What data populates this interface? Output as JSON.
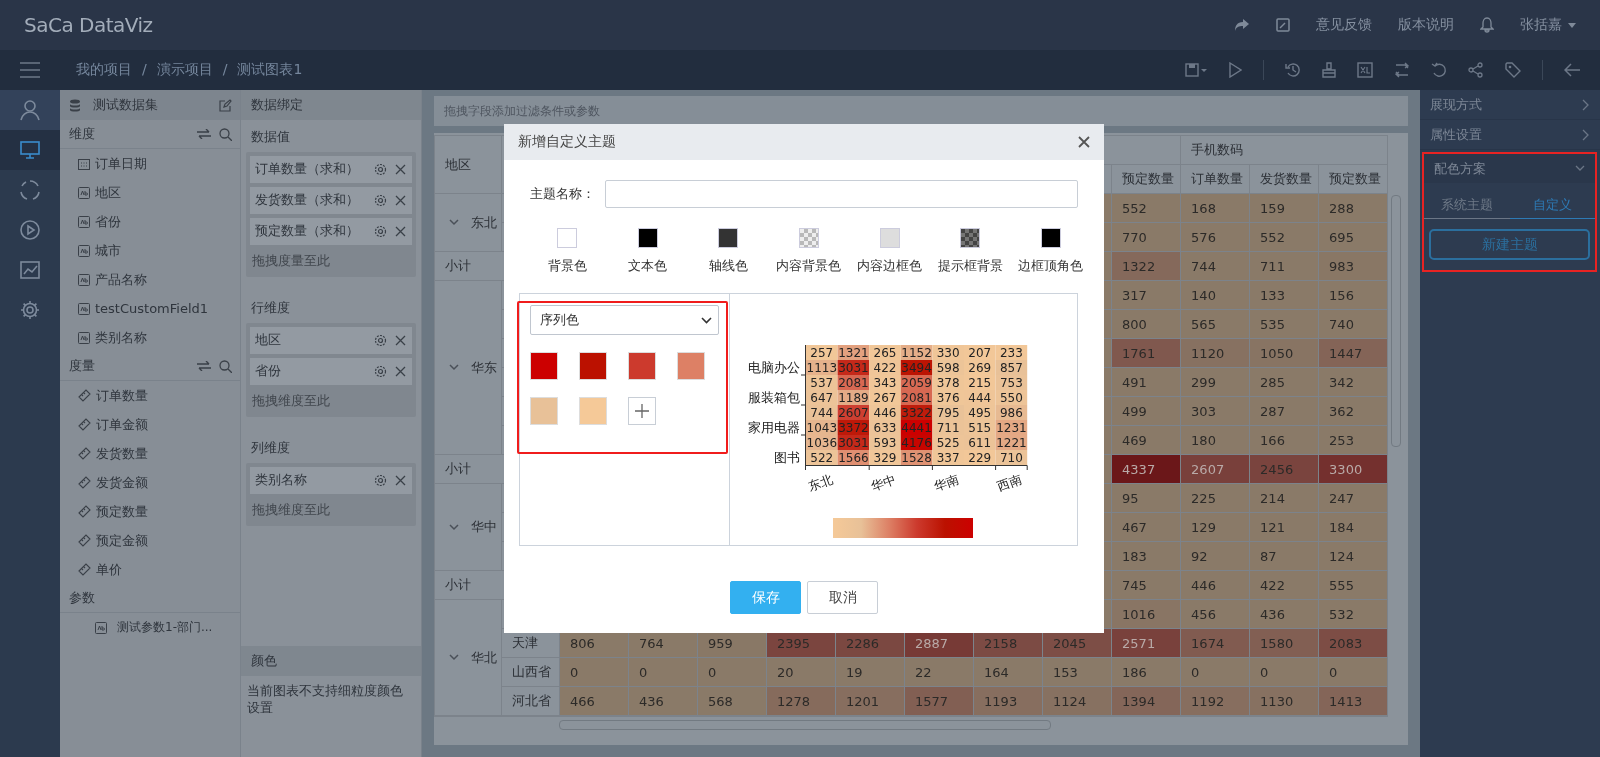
{
  "topbar": {
    "logo": "SaCa DataViz",
    "links": [
      "意见反馈",
      "版本说明"
    ],
    "user": "张括嘉"
  },
  "breadcrumb": {
    "items": [
      "我的项目",
      "演示项目",
      "测试图表1"
    ],
    "separator": "/"
  },
  "rail": [
    {
      "kind": "user",
      "selected": false
    },
    {
      "kind": "monitor",
      "selected": true
    },
    {
      "kind": "loader",
      "selected": false
    },
    {
      "kind": "play",
      "selected": false
    },
    {
      "kind": "chart",
      "selected": false
    },
    {
      "kind": "gear",
      "selected": false
    }
  ],
  "fields": {
    "dataset": "测试数据集",
    "sections": [
      {
        "title": "维度",
        "tools": true,
        "items": [
          {
            "kind": "date",
            "label": "订单日期"
          },
          {
            "kind": "text",
            "label": "地区"
          },
          {
            "kind": "text",
            "label": "省份"
          },
          {
            "kind": "text",
            "label": "城市"
          },
          {
            "kind": "text",
            "label": "产品名称"
          },
          {
            "kind": "text",
            "label": "testCustomField1"
          },
          {
            "kind": "text",
            "label": "类别名称"
          }
        ]
      },
      {
        "title": "度量",
        "tools": true,
        "items": [
          {
            "kind": "measure",
            "label": "订单数量"
          },
          {
            "kind": "measure",
            "label": "订单金额"
          },
          {
            "kind": "measure",
            "label": "发货数量"
          },
          {
            "kind": "measure",
            "label": "发货金额"
          },
          {
            "kind": "measure",
            "label": "预定数量"
          },
          {
            "kind": "measure",
            "label": "预定金额"
          },
          {
            "kind": "measure",
            "label": "单价"
          }
        ]
      },
      {
        "title": "参数",
        "tools": false,
        "items": [
          {
            "kind": "param",
            "label": "测试参数1-部门..."
          }
        ]
      }
    ]
  },
  "binding": {
    "title": "数据绑定",
    "groups": [
      {
        "title": "数据值",
        "chips": [
          "订单数量（求和）",
          "发货数量（求和）",
          "预定数量（求和）"
        ],
        "placeholder": "拖拽度量至此"
      },
      {
        "title": "行维度",
        "chips": [
          "地区",
          "省份"
        ],
        "placeholder": "拖拽维度至此"
      },
      {
        "title": "列维度",
        "chips": [
          "类别名称"
        ],
        "placeholder": "拖拽维度至此"
      }
    ],
    "color": {
      "title": "颜色",
      "note": "当前图表不支持细粒度颜色设置"
    }
  },
  "filter_hint": "拖拽字段添加过滤条件或参数",
  "table": {
    "region_header": "地区",
    "category": "手机数码",
    "measures": [
      "预定数量",
      "订单数量",
      "发货数量",
      "预定数量"
    ],
    "groups": [
      {
        "region": "东北",
        "expanded": true,
        "rows": [
          {
            "cells": [
              null,
              null,
              null,
              null,
              null,
              null,
              null,
              null,
              "552",
              "168",
              "159",
              "288"
            ]
          },
          {
            "cells": [
              null,
              null,
              null,
              null,
              null,
              null,
              null,
              null,
              "770",
              "576",
              "552",
              "695"
            ]
          }
        ],
        "subtotal": {
          "label": "小计",
          "cells": [
            null,
            null,
            null,
            null,
            null,
            null,
            null,
            null,
            "1322",
            "744",
            "711",
            "983"
          ]
        }
      },
      {
        "region": "华东",
        "expanded": true,
        "rows": [
          {
            "cells": [
              null,
              null,
              null,
              null,
              null,
              null,
              null,
              null,
              "317",
              "140",
              "133",
              "156"
            ]
          },
          {
            "cells": [
              null,
              null,
              null,
              null,
              null,
              null,
              null,
              null,
              "800",
              "565",
              "535",
              "740"
            ]
          },
          {
            "cells": [
              null,
              null,
              null,
              null,
              null,
              null,
              null,
              null,
              "1761",
              "1120",
              "1050",
              "1447"
            ]
          },
          {
            "cells": [
              null,
              null,
              null,
              null,
              null,
              null,
              null,
              null,
              "491",
              "299",
              "285",
              "342"
            ]
          },
          {
            "cells": [
              null,
              null,
              null,
              null,
              null,
              null,
              null,
              null,
              "499",
              "303",
              "287",
              "362"
            ]
          },
          {
            "cells": [
              null,
              null,
              null,
              null,
              null,
              null,
              null,
              null,
              "469",
              "180",
              "166",
              "253"
            ]
          }
        ],
        "subtotal": {
          "label": "小计",
          "cells": [
            null,
            null,
            null,
            null,
            null,
            null,
            null,
            null,
            "4337",
            "2607",
            "2456",
            "3300"
          ]
        }
      },
      {
        "region": "华中",
        "expanded": true,
        "rows": [
          {
            "cells": [
              null,
              null,
              null,
              null,
              null,
              null,
              null,
              null,
              "95",
              "225",
              "214",
              "247"
            ]
          },
          {
            "cells": [
              null,
              null,
              null,
              null,
              null,
              null,
              null,
              null,
              "467",
              "129",
              "121",
              "184"
            ]
          },
          {
            "cells": [
              null,
              null,
              null,
              null,
              null,
              null,
              null,
              null,
              "183",
              "92",
              "87",
              "124"
            ]
          }
        ],
        "subtotal": {
          "label": "小计",
          "cells": [
            null,
            null,
            null,
            null,
            null,
            null,
            null,
            null,
            "745",
            "446",
            "422",
            "555"
          ]
        }
      },
      {
        "region": "华北",
        "expanded": true,
        "rows": [
          {
            "cells": [
              null,
              null,
              null,
              null,
              null,
              null,
              null,
              null,
              "1016",
              "456",
              "436",
              "532"
            ]
          },
          {
            "province": "天津",
            "cells": [
              "806",
              "764",
              "959",
              "2395",
              "2286",
              "2887",
              "2158",
              "2045",
              "2571",
              "1674",
              "1580",
              "2083"
            ]
          },
          {
            "province": "山西省",
            "cells": [
              "0",
              "0",
              "0",
              "20",
              "19",
              "22",
              "164",
              "153",
              "186",
              "0",
              "0",
              "0"
            ]
          },
          {
            "province": "河北省",
            "cells": [
              "466",
              "436",
              "568",
              "1278",
              "1201",
              "1577",
              "1193",
              "1124",
              "1394",
              "1192",
              "1130",
              "1413"
            ]
          }
        ]
      }
    ]
  },
  "panel": {
    "sections": [
      {
        "title": "展现方式",
        "expanded": false
      },
      {
        "title": "属性设置",
        "expanded": false
      },
      {
        "title": "配色方案",
        "expanded": true,
        "highlighted": true
      }
    ],
    "tabs": [
      {
        "label": "系统主题",
        "selected": false
      },
      {
        "label": "自定义",
        "selected": true
      }
    ],
    "new_button": "新建主题"
  },
  "modal": {
    "title": "新增自定义主题",
    "name_label": "主题名称：",
    "theme_colors": [
      {
        "label": "背景色",
        "color": "#ffffff",
        "checker": false
      },
      {
        "label": "文本色",
        "color": "#000000",
        "checker": false
      },
      {
        "label": "轴线色",
        "color": "#333333",
        "checker": false
      },
      {
        "label": "内容背景色",
        "color": "#eeeeee",
        "checker": true
      },
      {
        "label": "内容边框色",
        "color": "#dddddd",
        "checker": false
      },
      {
        "label": "提示框背景",
        "color": "#444444",
        "checker": true
      },
      {
        "label": "边框顶角色",
        "color": "#000000",
        "checker": false
      }
    ],
    "palette": {
      "mode": "序列色",
      "highlighted": true,
      "colors": [
        {
          "color": "#cc0000"
        },
        {
          "color": "#bb1100"
        },
        {
          "color": "#cc3a2d"
        },
        {
          "color": "#dd8065"
        },
        {
          "color": "#e8c198"
        },
        {
          "color": "#f5c998"
        }
      ]
    },
    "preview": {
      "x_labels": [
        "东北",
        "华中",
        "华南",
        "西南"
      ],
      "rows": [
        {
          "values": [
            "257",
            "1321",
            "265",
            "1152",
            "330",
            "207",
            "233"
          ]
        },
        {
          "label": "电脑办公",
          "values": [
            "1113",
            "3031",
            "422",
            "3494",
            "598",
            "269",
            "857"
          ]
        },
        {
          "values": [
            "537",
            "2081",
            "343",
            "2059",
            "378",
            "215",
            "753"
          ]
        },
        {
          "label": "服装箱包",
          "values": [
            "647",
            "1189",
            "267",
            "2081",
            "376",
            "444",
            "550"
          ]
        },
        {
          "values": [
            "744",
            "2607",
            "446",
            "3322",
            "795",
            "495",
            "986"
          ]
        },
        {
          "label": "家用电器",
          "values": [
            "1043",
            "3372",
            "633",
            "4441",
            "711",
            "515",
            "1231"
          ]
        },
        {
          "values": [
            "1036",
            "3031",
            "593",
            "4176",
            "525",
            "611",
            "1221"
          ]
        },
        {
          "label": "图书",
          "values": [
            "522",
            "1566",
            "329",
            "1528",
            "337",
            "229",
            "710"
          ]
        }
      ]
    },
    "buttons": [
      {
        "label": "保存",
        "kind": "primary"
      },
      {
        "label": "取消",
        "kind": "default"
      }
    ]
  }
}
